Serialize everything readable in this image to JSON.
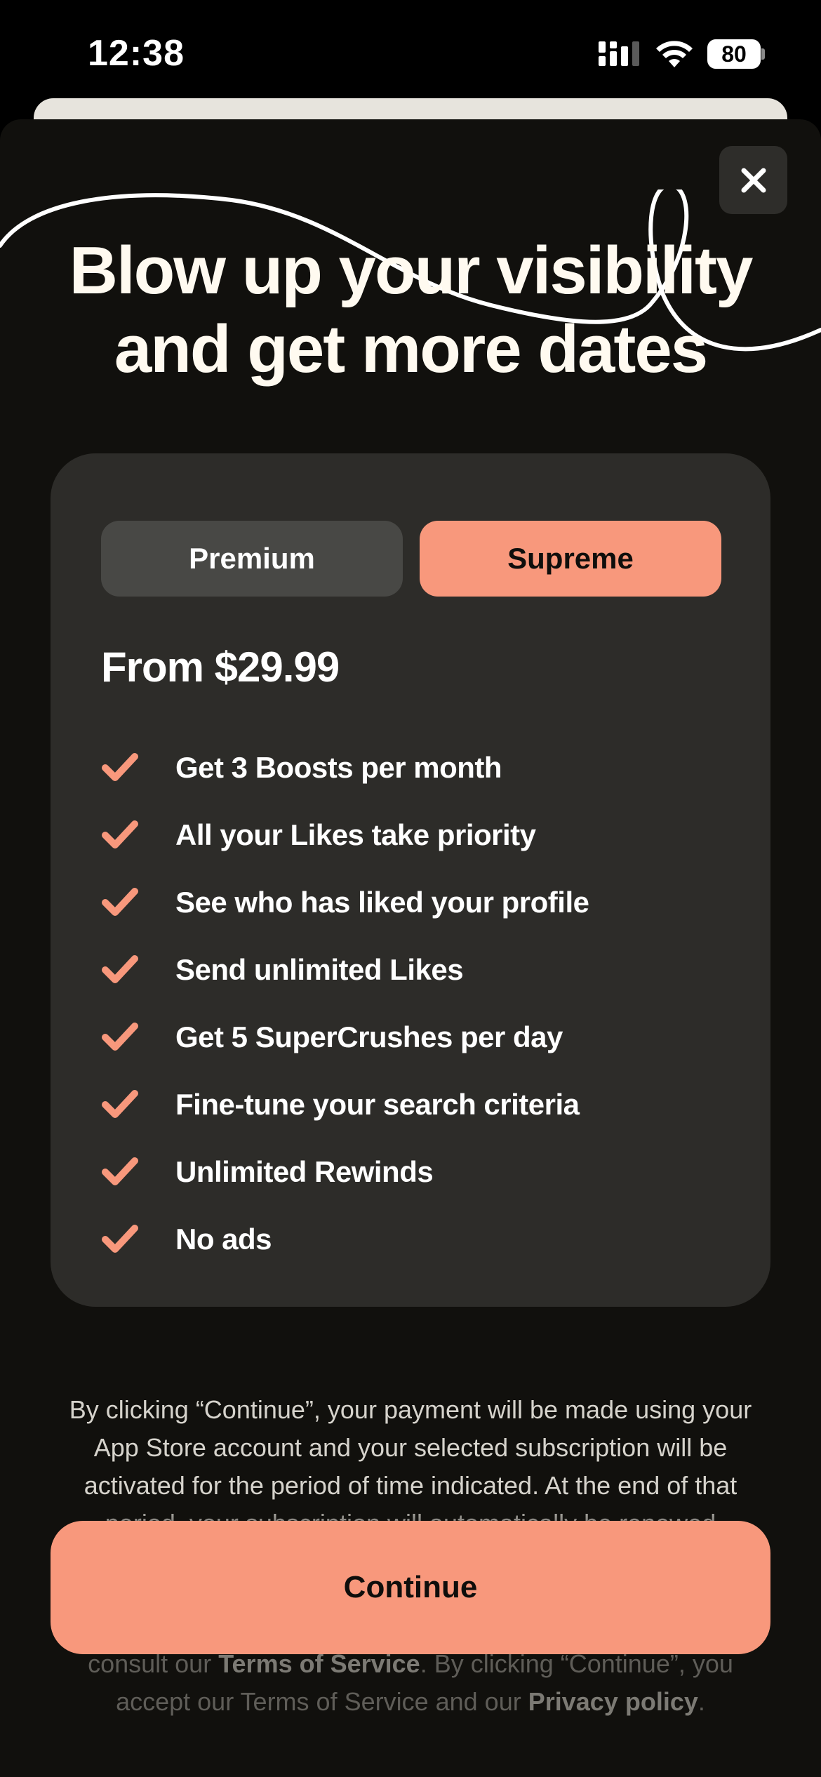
{
  "status_bar": {
    "time": "12:38",
    "battery_level": "80",
    "icons": [
      "cellular-signal-icon",
      "wifi-icon",
      "battery-icon"
    ]
  },
  "paywall": {
    "close_icon": "close-icon",
    "headline_line1": "Blow up your visibility",
    "headline_line2": "and get more dates",
    "plans": [
      {
        "label": "Premium",
        "selected": false
      },
      {
        "label": "Supreme",
        "selected": true
      }
    ],
    "price": "From $29.99",
    "features": [
      "Get 3 Boosts per month",
      "All your Likes take priority",
      "See who has liked your profile",
      "Send unlimited Likes",
      "Get 5 SuperCrushes per day",
      "Fine-tune your search criteria",
      "Unlimited Rewinds",
      "No ads"
    ],
    "legal_text": "By clicking “Continue”, your payment will be made using your App Store account and your selected subscription will be activated for the period of time indicated. At the end of that period, your subscription will automatically be renewed",
    "legal_tail_prefix": "consult our",
    "terms_link": "Terms of Service",
    "legal_tail_middle": ". By clicking “Continue”, you accept our Terms of Service and our",
    "privacy_link": "Privacy policy",
    "legal_tail_end": ".",
    "continue_label": "Continue"
  },
  "colors": {
    "accent": "#f8987c",
    "background": "#11100d",
    "card": "#2d2c29",
    "tab_inactive": "#484845"
  }
}
